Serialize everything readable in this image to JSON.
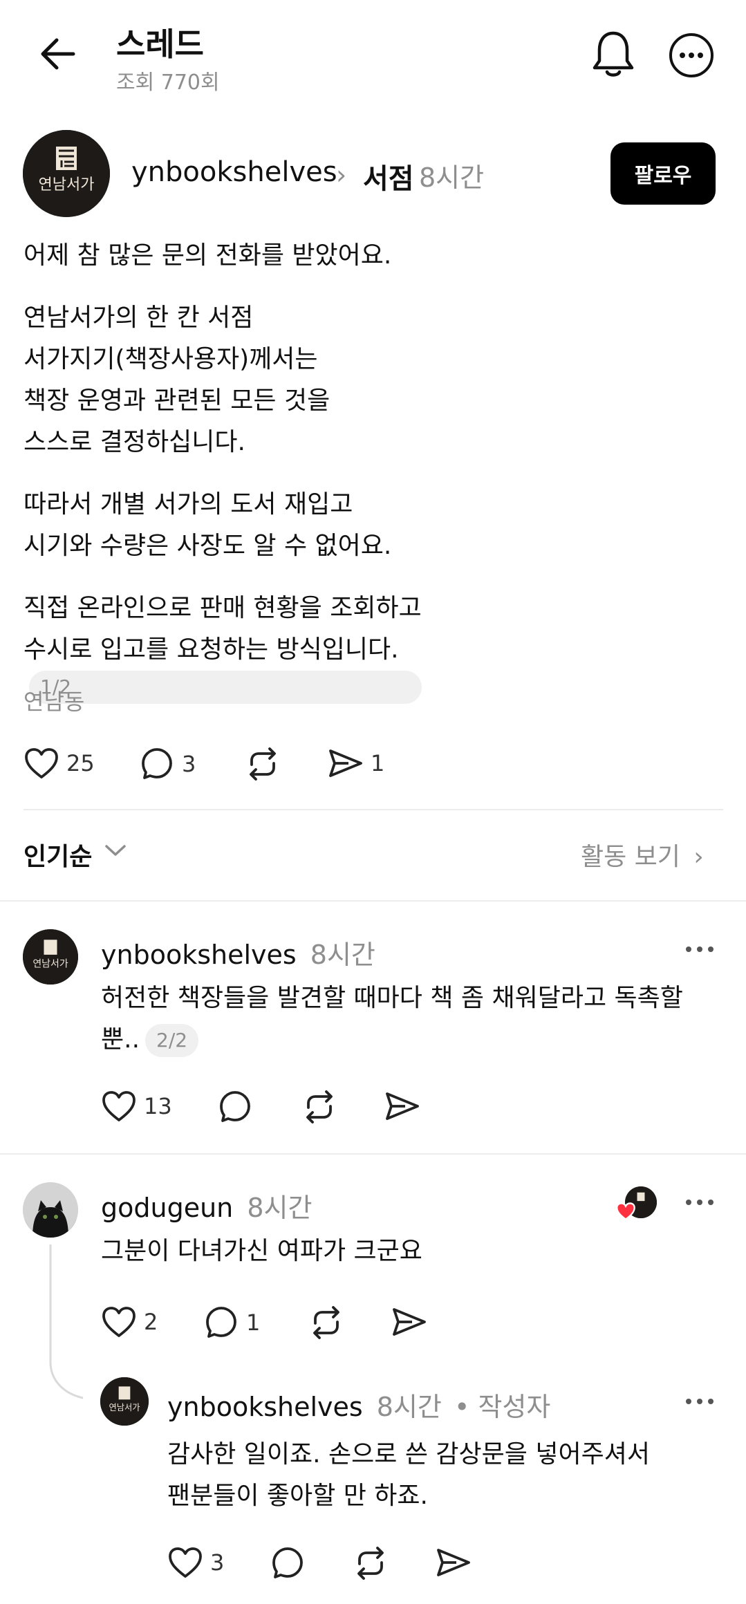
{
  "header": {
    "title": "스레드",
    "views": "조회 770회"
  },
  "post": {
    "author": "ynbookshelves",
    "topic": "서점",
    "time": "8시간",
    "follow_label": "팔로우",
    "avatar_text": "연남서가",
    "paragraphs": [
      [
        "어제 참 많은 문의 전화를 받았어요."
      ],
      [
        "연남서가의 한 칸 서점",
        "서가지기(책장사용자)께서는",
        "책장 운영과 관련된 모든 것을",
        "스스로 결정하십니다."
      ],
      [
        "따라서 개별 서가의 도서 재입고",
        "시기와 수량은 사장도 알 수 없어요."
      ],
      [
        "직접 온라인으로 판매 현황을 조회하고",
        "수시로 입고를 요청하는 방식입니다."
      ]
    ],
    "page_badge": "1/2",
    "location": "연남동",
    "likes": "25",
    "replies": "3",
    "reposts": "",
    "shares": "1"
  },
  "sort": {
    "label": "인기순",
    "activity_label": "활동 보기"
  },
  "comments": [
    {
      "author": "ynbookshelves",
      "time": "8시간",
      "lines": [
        "허전한 책장들을 발견할 때마다 책 좀 채워달라고 독촉할",
        "뿐.."
      ],
      "page_badge": "2/2",
      "likes": "13",
      "replies": ""
    },
    {
      "author": "godugeun",
      "time": "8시간",
      "text": "그분이 다녀가신 여파가 크군요",
      "likes": "2",
      "replies": "1"
    },
    {
      "author": "ynbookshelves",
      "time": "8시간",
      "author_tag": "• 작성자",
      "lines": [
        "감사한 일이죠. 손으로 쓴 감상문을 넣어주셔서",
        "팬분들이 좋아할 만 하죠."
      ],
      "likes": "3",
      "replies": ""
    }
  ],
  "colors": {
    "text": "#111111",
    "secondary": "#8e8e8e",
    "follow_bg": "#000000",
    "heart_badge": "#ff3040",
    "divider": "#ececec"
  }
}
